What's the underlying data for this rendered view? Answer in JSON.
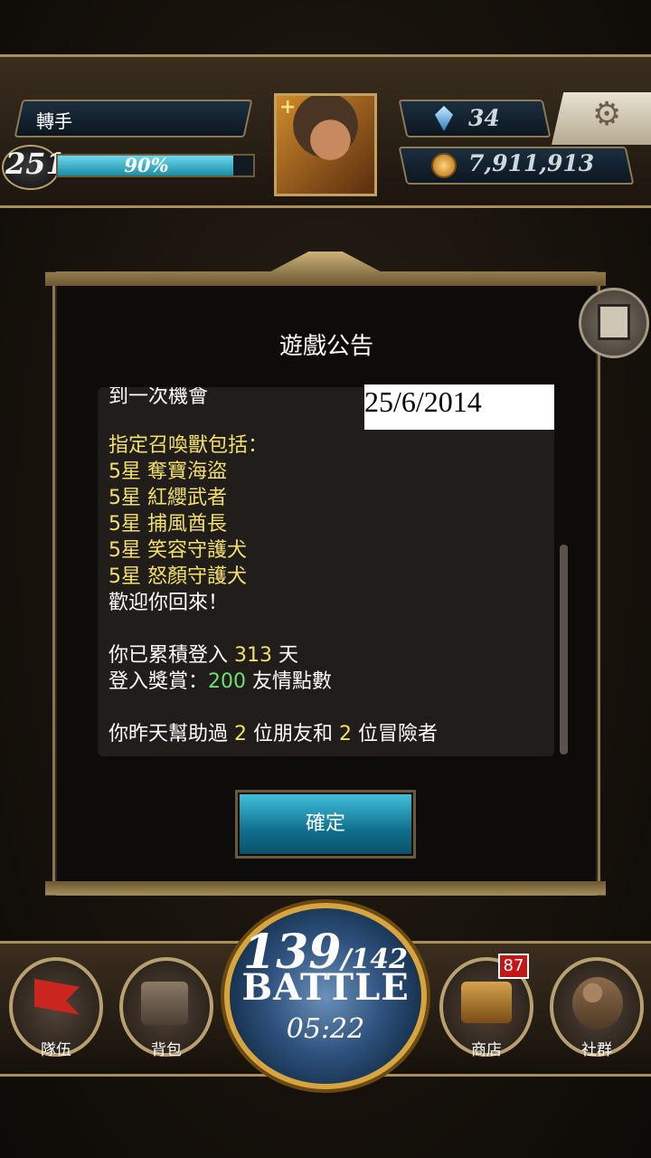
{
  "player": {
    "name": "轉手",
    "level": "251",
    "exp_percent_text": "90%",
    "exp_fraction": 0.9,
    "gems": "34",
    "coins": "7,911,913"
  },
  "dialog": {
    "title": "遊戲公告",
    "cut_line": "到一次機會",
    "date_stamp": "25/6/2014",
    "lines": {
      "l1": "指定召喚獸包括：",
      "l2": "5星 奪寶海盜",
      "l3": "5星 紅纓武者",
      "l4": "5星 捕風酋長",
      "l5": "5星 笑容守護犬",
      "l6": "5星 怒顏守護犬",
      "l7": "歡迎你回來！",
      "l8_a": "你已累積登入 ",
      "l8_n": "313",
      "l8_b": " 天",
      "l9_a": "登入獎賞：",
      "l9_n": "200",
      "l9_b": " 友情點數",
      "l10_a": "你昨天幫助過 ",
      "l10_n1": "2",
      "l10_b": " 位朋友和 ",
      "l10_n2": "2",
      "l10_c": " 位冒險者"
    },
    "confirm_label": "確定"
  },
  "battle": {
    "stamina_current": "139",
    "stamina_max": "/142",
    "label": "BATTLE",
    "timer": "05:22"
  },
  "nav": {
    "team": "隊伍",
    "bag": "背包",
    "shop": "商店",
    "shop_badge": "87",
    "social": "社群"
  },
  "icons": [
    "plus-icon",
    "gem-icon",
    "coin-icon",
    "gear-icon",
    "notice-tab-icon",
    "flag-icon",
    "bag-icon",
    "chest-icon",
    "social-icon"
  ],
  "colors": {
    "highlight_yellow": "#f3df6c",
    "highlight_green": "#6fe06f",
    "confirm_button": "#1a8ea8",
    "badge_red": "#c31616"
  }
}
